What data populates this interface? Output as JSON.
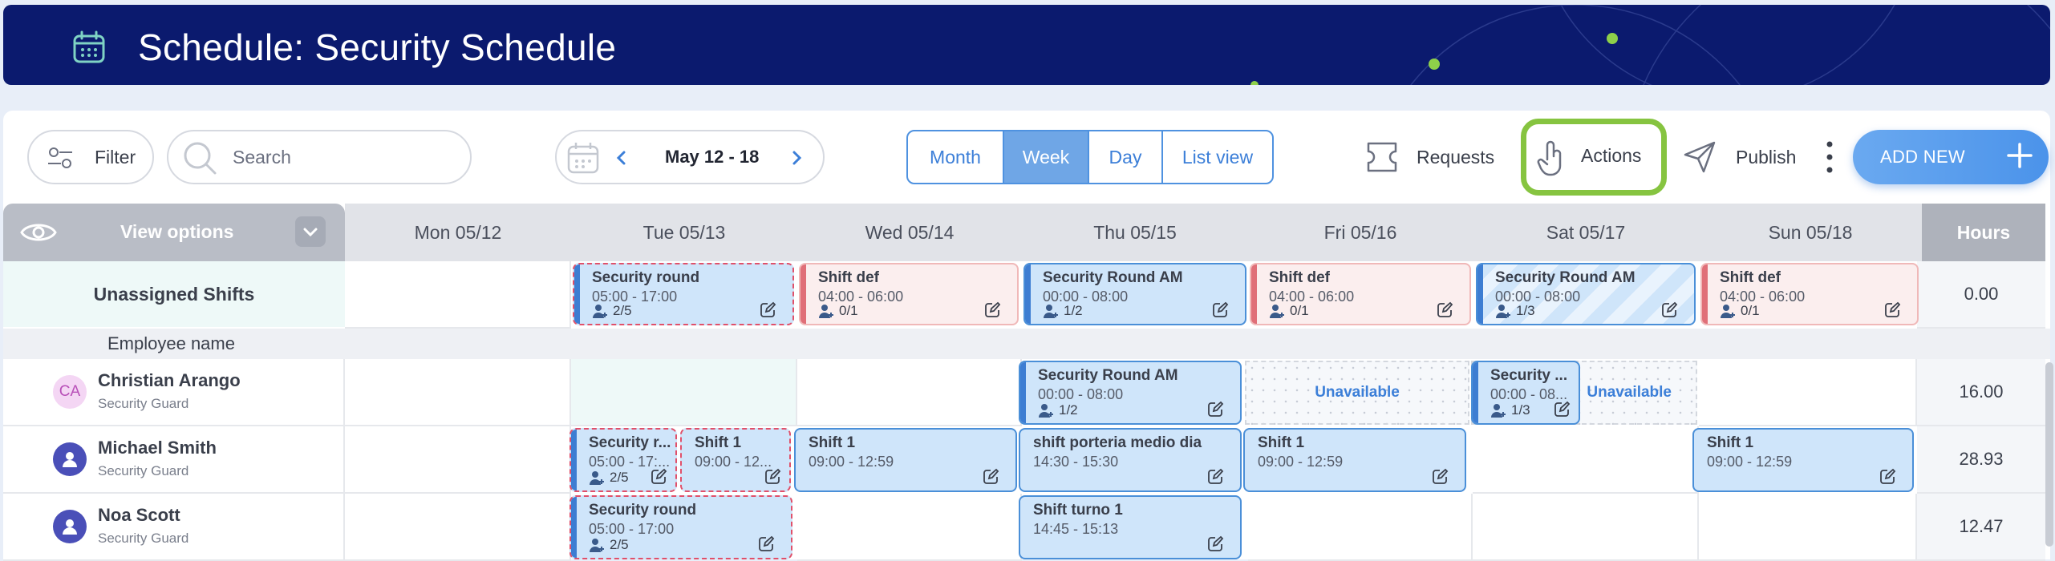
{
  "header": {
    "title": "Schedule: Security Schedule",
    "icon": "calendar-icon"
  },
  "toolbar": {
    "filter_label": "Filter",
    "search_placeholder": "Search",
    "date_range": "May 12 - 18",
    "views": [
      "Month",
      "Week",
      "Day",
      "List view"
    ],
    "active_view": "Week",
    "requests_label": "Requests",
    "actions_label": "Actions",
    "publish_label": "Publish",
    "add_new_label": "ADD NEW"
  },
  "grid": {
    "view_options_label": "View options",
    "days": [
      "Mon 05/12",
      "Tue 05/13",
      "Wed 05/14",
      "Thu 05/15",
      "Fri 05/16",
      "Sat 05/17",
      "Sun 05/18"
    ],
    "hours_label": "Hours",
    "unassigned_label": "Unassigned Shifts",
    "unassigned_hours": "0.00",
    "employee_name_label": "Employee name",
    "unavailable_label": "Unavailable"
  },
  "unassigned_shifts": [
    {
      "title": "Security round",
      "time": "05:00 - 17:00",
      "count": "2/5"
    },
    {
      "title": "Shift def",
      "time": "04:00 - 06:00",
      "count": "0/1"
    },
    {
      "title": "Security Round AM",
      "time": "00:00 - 08:00",
      "count": "1/2"
    },
    {
      "title": "Shift def",
      "time": "04:00 - 06:00",
      "count": "0/1"
    },
    {
      "title": "Security Round AM",
      "time": "00:00 - 08:00",
      "count": "1/3"
    },
    {
      "title": "Shift def",
      "time": "04:00 - 06:00",
      "count": "0/1"
    }
  ],
  "employees": [
    {
      "initials": "CA",
      "name": "Christian Arango",
      "role": "Security Guard",
      "hours": "16.00",
      "shifts": [
        {
          "title": "Security Round AM",
          "time": "00:00 - 08:00",
          "count": "1/2"
        },
        {
          "title": "Security ...",
          "time": "00:00 - 08...",
          "count": "1/3"
        }
      ]
    },
    {
      "initials": "",
      "name": "Michael Smith",
      "role": "Security Guard",
      "hours": "28.93",
      "shifts": [
        {
          "title": "Security r...",
          "time": "05:00 - 17:...",
          "count": "2/5"
        },
        {
          "title": "Shift 1",
          "time": "09:00 - 12..."
        },
        {
          "title": "Shift 1",
          "time": "09:00 - 12:59"
        },
        {
          "title": "shift porteria medio dia",
          "time": "14:30 - 15:30"
        },
        {
          "title": "Shift 1",
          "time": "09:00 - 12:59"
        },
        {
          "title": "Shift 1",
          "time": "09:00 - 12:59"
        }
      ]
    },
    {
      "initials": "",
      "name": "Noa Scott",
      "role": "Security Guard",
      "hours": "12.47",
      "shifts": [
        {
          "title": "Security round",
          "time": "05:00 - 17:00",
          "count": "2/5"
        },
        {
          "title": "Shift turno 1",
          "time": "14:45 - 15:13"
        }
      ]
    }
  ],
  "colors": {
    "banner": "#0b1a6e",
    "accent": "#4f92e0",
    "highlight": "#86c440",
    "unassigned_bg": "#eef9f8"
  }
}
